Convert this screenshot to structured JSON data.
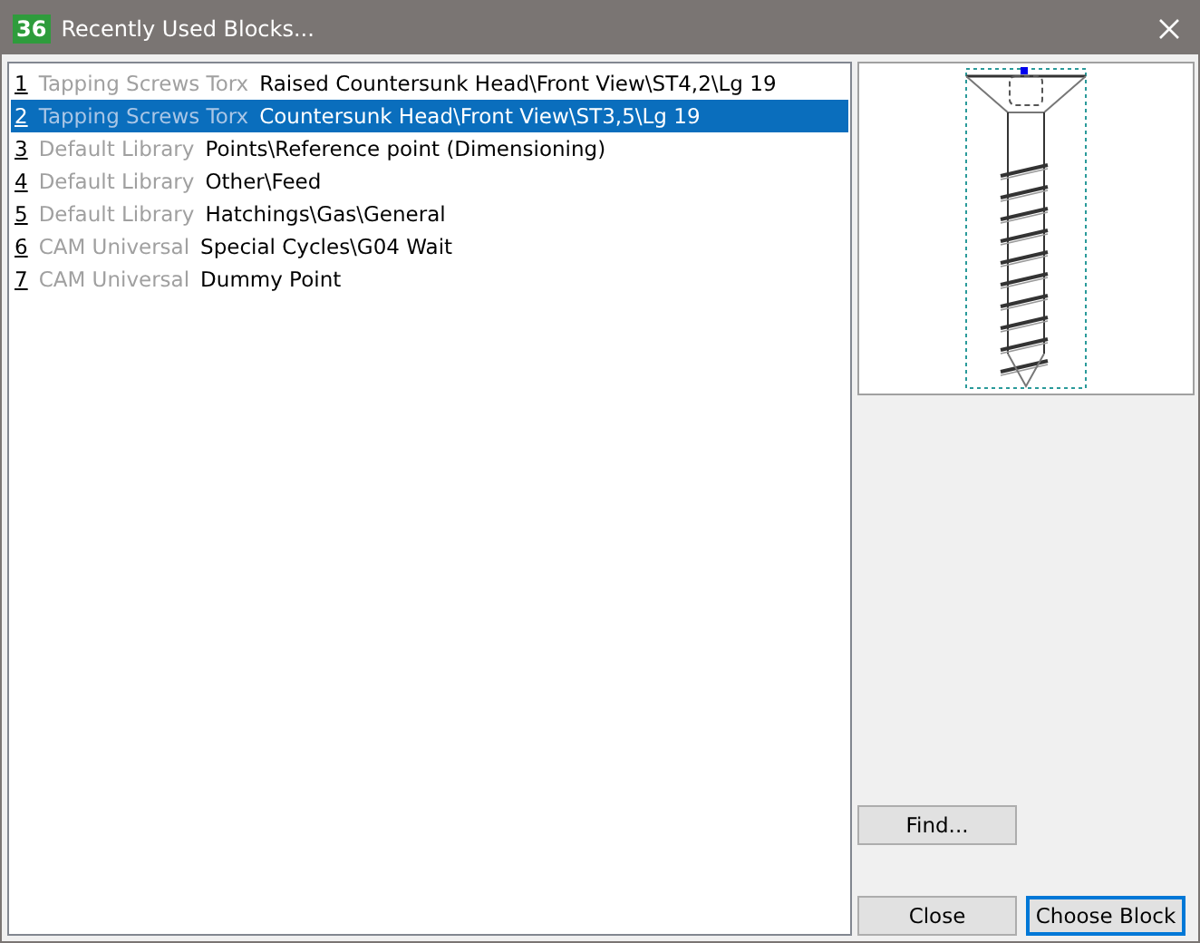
{
  "window": {
    "title": "Recently Used Blocks...",
    "icon_text": "36"
  },
  "blocks": [
    {
      "number": "1",
      "library": "Tapping Screws Torx",
      "path": "Raised Countersunk Head\\Front View\\ST4,2\\Lg 19",
      "selected": false
    },
    {
      "number": "2",
      "library": "Tapping Screws Torx",
      "path": "Countersunk Head\\Front View\\ST3,5\\Lg 19",
      "selected": true
    },
    {
      "number": "3",
      "library": "Default Library",
      "path": "Points\\Reference point (Dimensioning)",
      "selected": false
    },
    {
      "number": "4",
      "library": "Default Library",
      "path": "Other\\Feed",
      "selected": false
    },
    {
      "number": "5",
      "library": "Default Library",
      "path": "Hatchings\\Gas\\General",
      "selected": false
    },
    {
      "number": "6",
      "library": "CAM Universal",
      "path": "Special Cycles\\G04 Wait",
      "selected": false
    },
    {
      "number": "7",
      "library": "CAM Universal",
      "path": "Dummy Point",
      "selected": false
    }
  ],
  "buttons": {
    "find": "Find...",
    "close": "Close",
    "choose": "Choose Block"
  }
}
